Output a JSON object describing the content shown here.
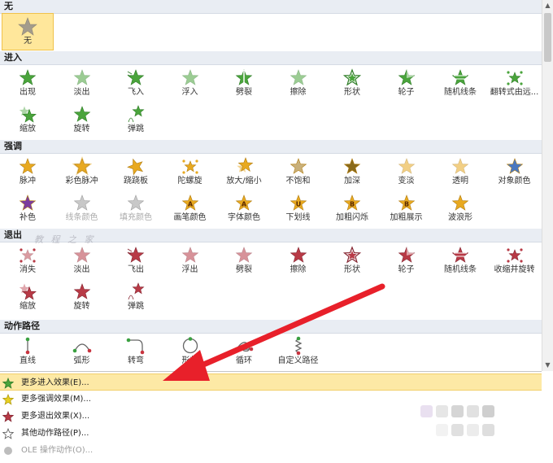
{
  "none": {
    "header": "无",
    "label": "无"
  },
  "sections": {
    "entrance": {
      "header": "进入",
      "items": [
        {
          "label": "出现",
          "style": "green"
        },
        {
          "label": "淡出",
          "style": "green-fade"
        },
        {
          "label": "飞入",
          "style": "green-fly"
        },
        {
          "label": "浮入",
          "style": "green-light"
        },
        {
          "label": "劈裂",
          "style": "green-split"
        },
        {
          "label": "擦除",
          "style": "green-fade"
        },
        {
          "label": "形状",
          "style": "green-outline"
        },
        {
          "label": "轮子",
          "style": "green-wheel"
        },
        {
          "label": "随机线条",
          "style": "green-lines"
        },
        {
          "label": "翻转式由远...",
          "style": "green-flip"
        },
        {
          "label": "缩放",
          "style": "green-zoom"
        },
        {
          "label": "旋转",
          "style": "green"
        },
        {
          "label": "弹跳",
          "style": "green-bounce"
        }
      ]
    },
    "emphasis": {
      "header": "强调",
      "items": [
        {
          "label": "脉冲",
          "style": "gold"
        },
        {
          "label": "彩色脉冲",
          "style": "gold-pulse"
        },
        {
          "label": "跷跷板",
          "style": "gold-seesaw"
        },
        {
          "label": "陀螺旋",
          "style": "gold-spin"
        },
        {
          "label": "放大/缩小",
          "style": "gold-grow"
        },
        {
          "label": "不饱和",
          "style": "gold-desat"
        },
        {
          "label": "加深",
          "style": "gold-dark"
        },
        {
          "label": "变淡",
          "style": "gold-light"
        },
        {
          "label": "透明",
          "style": "gold-trans"
        },
        {
          "label": "对象颜色",
          "style": "gold-object"
        },
        {
          "label": "补色",
          "style": "gold-purple"
        },
        {
          "label": "线条颜色",
          "style": "gray",
          "dim": true
        },
        {
          "label": "填充颜色",
          "style": "gray",
          "dim": true
        },
        {
          "label": "画笔颜色",
          "style": "gold-a"
        },
        {
          "label": "字体颜色",
          "style": "gold-a"
        },
        {
          "label": "下划线",
          "style": "gold-u"
        },
        {
          "label": "加粗闪烁",
          "style": "gold-b"
        },
        {
          "label": "加粗展示",
          "style": "gold-b"
        },
        {
          "label": "波浪形",
          "style": "gold"
        }
      ]
    },
    "exit": {
      "header": "退出",
      "items": [
        {
          "label": "消失",
          "style": "red-disappear"
        },
        {
          "label": "淡出",
          "style": "red-fade"
        },
        {
          "label": "飞出",
          "style": "red-fly"
        },
        {
          "label": "浮出",
          "style": "red-light"
        },
        {
          "label": "劈裂",
          "style": "red-light"
        },
        {
          "label": "擦除",
          "style": "red"
        },
        {
          "label": "形状",
          "style": "red-outline"
        },
        {
          "label": "轮子",
          "style": "red-wheel"
        },
        {
          "label": "随机线条",
          "style": "red-lines"
        },
        {
          "label": "收缩并旋转",
          "style": "red-spin"
        },
        {
          "label": "缩放",
          "style": "red-zoom"
        },
        {
          "label": "旋转",
          "style": "red"
        },
        {
          "label": "弹跳",
          "style": "red-bounce"
        }
      ]
    },
    "motion": {
      "header": "动作路径",
      "items": [
        {
          "label": "直线",
          "style": "path-line"
        },
        {
          "label": "弧形",
          "style": "path-arc"
        },
        {
          "label": "转弯",
          "style": "path-turn"
        },
        {
          "label": "形状",
          "style": "path-shape"
        },
        {
          "label": "循环",
          "style": "path-loop"
        },
        {
          "label": "自定义路径",
          "style": "path-custom"
        }
      ]
    }
  },
  "menu": [
    {
      "label": "更多进入效果(E)...",
      "icon": "green-star-icon",
      "highlighted": true,
      "disabled": false
    },
    {
      "label": "更多强调效果(M)...",
      "icon": "gold-star-icon",
      "highlighted": false,
      "disabled": false
    },
    {
      "label": "更多退出效果(X)...",
      "icon": "red-star-icon",
      "highlighted": false,
      "disabled": false
    },
    {
      "label": "其他动作路径(P)...",
      "icon": "outline-star-icon",
      "highlighted": false,
      "disabled": false
    },
    {
      "label": "OLE 操作动作(O)...",
      "icon": "ole-icon",
      "highlighted": false,
      "disabled": true
    }
  ],
  "watermark": {
    "text": "教 程 之 家"
  },
  "colors": {
    "green": "#4aa43c",
    "gold": "#e8a920",
    "red": "#b83a46",
    "highlight": "#fde9a5",
    "arrow": "#e8202a"
  }
}
